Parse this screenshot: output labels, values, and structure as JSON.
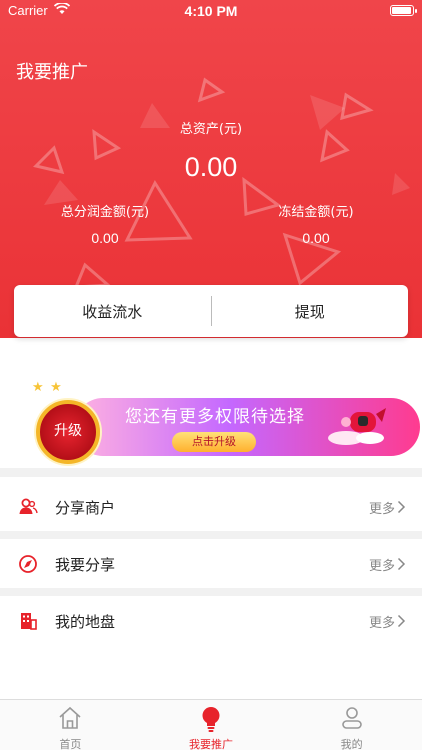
{
  "status_bar": {
    "carrier": "Carrier",
    "time": "4:10 PM"
  },
  "header": {
    "title": "我要推广",
    "total_assets_label": "总资产(元)",
    "total_assets_value": "0.00",
    "profit_label": "总分润金额(元)",
    "profit_value": "0.00",
    "frozen_label": "冻结金额(元)",
    "frozen_value": "0.00"
  },
  "actions": {
    "income_flow": "收益流水",
    "withdraw": "提现"
  },
  "banner": {
    "medal_label": "升级",
    "headline": "您还有更多权限待选择",
    "button": "点击升级"
  },
  "menu": [
    {
      "label": "分享商户",
      "more": "更多",
      "icon": "user-share-icon"
    },
    {
      "label": "我要分享",
      "more": "更多",
      "icon": "compass-share-icon"
    },
    {
      "label": "我的地盘",
      "more": "更多",
      "icon": "building-icon"
    }
  ],
  "tabs": [
    {
      "label": "首页",
      "icon": "home-icon",
      "active": false
    },
    {
      "label": "我要推广",
      "icon": "lightbulb-icon",
      "active": true
    },
    {
      "label": "我的",
      "icon": "person-icon",
      "active": false
    }
  ],
  "colors": {
    "brand_red": "#ea3236",
    "muted_text": "#888888",
    "banner_purple": "#c468ff"
  }
}
